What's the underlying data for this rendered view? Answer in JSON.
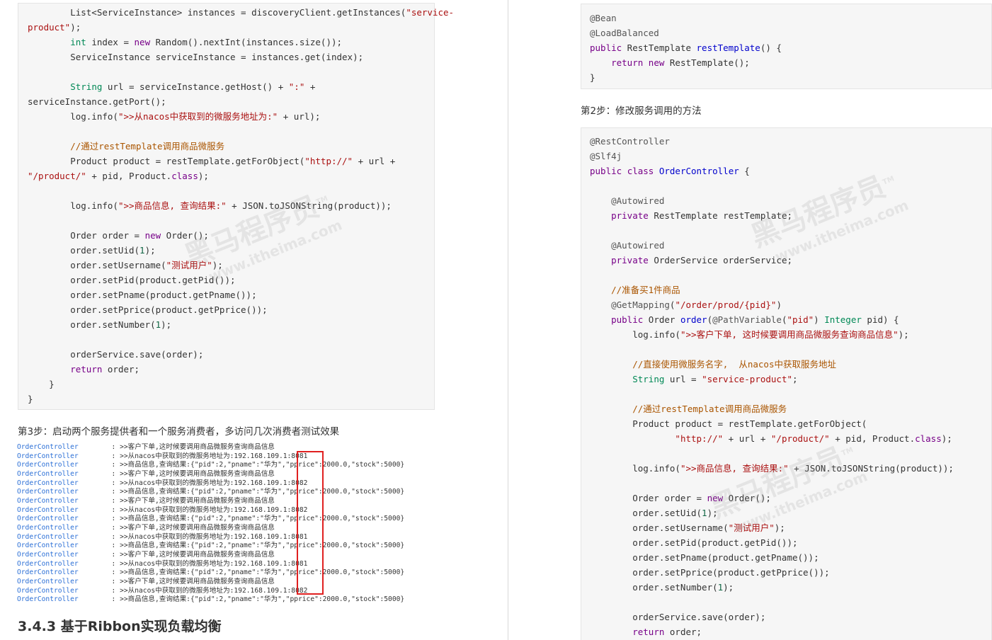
{
  "left": {
    "code_lines": [
      [
        [
          "t",
          "        List<ServiceInstance> instances = discoveryClient.getInstances("
        ],
        [
          "st",
          "\"service-"
        ]
      ],
      [
        [
          "st",
          "product\""
        ],
        [
          "t",
          ");"
        ]
      ],
      [
        [
          "t",
          "        "
        ],
        [
          "ty",
          "int"
        ],
        [
          "t",
          " index = "
        ],
        [
          "kw",
          "new"
        ],
        [
          "t",
          " Random().nextInt(instances.size());"
        ]
      ],
      [
        [
          "t",
          "        ServiceInstance serviceInstance = instances.get(index);"
        ]
      ],
      [
        [
          "t",
          ""
        ]
      ],
      [
        [
          "t",
          "        "
        ],
        [
          "ty",
          "String"
        ],
        [
          "t",
          " url = serviceInstance.getHost() + "
        ],
        [
          "st",
          "\":\""
        ],
        [
          "t",
          " +"
        ]
      ],
      [
        [
          "t",
          "serviceInstance.getPort();"
        ]
      ],
      [
        [
          "t",
          "        log.info("
        ],
        [
          "st",
          "\">>从nacos中获取到的微服务地址为:\""
        ],
        [
          "t",
          " + url);"
        ]
      ],
      [
        [
          "t",
          ""
        ]
      ],
      [
        [
          "t",
          "        "
        ],
        [
          "cm",
          "//通过restTemplate调用商品微服务"
        ]
      ],
      [
        [
          "t",
          "        Product product = restTemplate.getForObject("
        ],
        [
          "st",
          "\"http://\""
        ],
        [
          "t",
          " + url +"
        ]
      ],
      [
        [
          "st",
          "\"/product/\""
        ],
        [
          "t",
          " + pid, Product."
        ],
        [
          "kw",
          "class"
        ],
        [
          "t",
          ");"
        ]
      ],
      [
        [
          "t",
          ""
        ]
      ],
      [
        [
          "t",
          "        log.info("
        ],
        [
          "st",
          "\">>商品信息, 查询结果:\""
        ],
        [
          "t",
          " + JSON.toJSONString(product));"
        ]
      ],
      [
        [
          "t",
          ""
        ]
      ],
      [
        [
          "t",
          "        Order order = "
        ],
        [
          "kw",
          "new"
        ],
        [
          "t",
          " Order();"
        ]
      ],
      [
        [
          "t",
          "        order.setUid("
        ],
        [
          "nm",
          "1"
        ],
        [
          "t",
          ");"
        ]
      ],
      [
        [
          "t",
          "        order.setUsername("
        ],
        [
          "st",
          "\"测试用户\""
        ],
        [
          "t",
          ");"
        ]
      ],
      [
        [
          "t",
          "        order.setPid(product.getPid());"
        ]
      ],
      [
        [
          "t",
          "        order.setPname(product.getPname());"
        ]
      ],
      [
        [
          "t",
          "        order.setPprice(product.getPprice());"
        ]
      ],
      [
        [
          "t",
          "        order.setNumber("
        ],
        [
          "nm",
          "1"
        ],
        [
          "t",
          ");"
        ]
      ],
      [
        [
          "t",
          ""
        ]
      ],
      [
        [
          "t",
          "        orderService.save(order);"
        ]
      ],
      [
        [
          "t",
          "        "
        ],
        [
          "kw",
          "return"
        ],
        [
          "t",
          " order;"
        ]
      ],
      [
        [
          "t",
          "    }"
        ]
      ],
      [
        [
          "t",
          "}"
        ]
      ]
    ],
    "step3": "第3步：启动两个服务提供者和一个服务消费者，多访问几次消费者测试效果",
    "log_lines": [
      [
        "OrderController",
        "  : >>客户下单,这时候要调用商品微服务查询商品信息"
      ],
      [
        "OrderController",
        "  : >>从nacos中获取到的微服务地址为:192.168.109.1:8081"
      ],
      [
        "OrderController",
        "  : >>商品信息,查询结果:{\"pid\":2,\"pname\":\"华为\",\"pprice\":2000.0,\"stock\":5000}"
      ],
      [
        "OrderController",
        "  : >>客户下单,这时候要调用商品微服务查询商品信息"
      ],
      [
        "OrderController",
        "  : >>从nacos中获取到的微服务地址为:192.168.109.1:8082"
      ],
      [
        "OrderController",
        "  : >>商品信息,查询结果:{\"pid\":2,\"pname\":\"华为\",\"pprice\":2000.0,\"stock\":5000}"
      ],
      [
        "OrderController",
        "  : >>客户下单,这时候要调用商品微服务查询商品信息"
      ],
      [
        "OrderController",
        "  : >>从nacos中获取到的微服务地址为:192.168.109.1:8082"
      ],
      [
        "OrderController",
        "  : >>商品信息,查询结果:{\"pid\":2,\"pname\":\"华为\",\"pprice\":2000.0,\"stock\":5000}"
      ],
      [
        "OrderController",
        "  : >>客户下单,这时候要调用商品微服务查询商品信息"
      ],
      [
        "OrderController",
        "  : >>从nacos中获取到的微服务地址为:192.168.109.1:8081"
      ],
      [
        "OrderController",
        "  : >>商品信息,查询结果:{\"pid\":2,\"pname\":\"华为\",\"pprice\":2000.0,\"stock\":5000}"
      ],
      [
        "OrderController",
        "  : >>客户下单,这时候要调用商品微服务查询商品信息"
      ],
      [
        "OrderController",
        "  : >>从nacos中获取到的微服务地址为:192.168.109.1:8081"
      ],
      [
        "OrderController",
        "  : >>商品信息,查询结果:{\"pid\":2,\"pname\":\"华为\",\"pprice\":2000.0,\"stock\":5000}"
      ],
      [
        "OrderController",
        "  : >>客户下单,这时候要调用商品微服务查询商品信息"
      ],
      [
        "OrderController",
        "  : >>从nacos中获取到的微服务地址为:192.168.109.1:8082"
      ],
      [
        "OrderController",
        "  : >>商品信息,查询结果:{\"pid\":2,\"pname\":\"华为\",\"pprice\":2000.0,\"stock\":5000}"
      ]
    ],
    "heading": "3.4.3 基于Ribbon实现负载均衡"
  },
  "right": {
    "code1_lines": [
      [
        [
          "an",
          "@Bean"
        ]
      ],
      [
        [
          "an",
          "@LoadBalanced"
        ]
      ],
      [
        [
          "kw",
          "public"
        ],
        [
          "t",
          " RestTemplate "
        ],
        [
          "fn",
          "restTemplate"
        ],
        [
          "t",
          "() {"
        ]
      ],
      [
        [
          "t",
          "    "
        ],
        [
          "kw",
          "return"
        ],
        [
          "t",
          " "
        ],
        [
          "kw",
          "new"
        ],
        [
          "t",
          " RestTemplate();"
        ]
      ],
      [
        [
          "t",
          "}"
        ]
      ]
    ],
    "step2": "第2步：修改服务调用的方法",
    "code2_lines": [
      [
        [
          "an",
          "@RestController"
        ]
      ],
      [
        [
          "an",
          "@Slf4j"
        ]
      ],
      [
        [
          "kw",
          "public"
        ],
        [
          "t",
          " "
        ],
        [
          "kw",
          "class"
        ],
        [
          "t",
          " "
        ],
        [
          "fn",
          "OrderController"
        ],
        [
          "t",
          " {"
        ]
      ],
      [
        [
          "t",
          ""
        ]
      ],
      [
        [
          "t",
          "    "
        ],
        [
          "an",
          "@Autowired"
        ]
      ],
      [
        [
          "t",
          "    "
        ],
        [
          "kw",
          "private"
        ],
        [
          "t",
          " RestTemplate restTemplate;"
        ]
      ],
      [
        [
          "t",
          ""
        ]
      ],
      [
        [
          "t",
          "    "
        ],
        [
          "an",
          "@Autowired"
        ]
      ],
      [
        [
          "t",
          "    "
        ],
        [
          "kw",
          "private"
        ],
        [
          "t",
          " OrderService orderService;"
        ]
      ],
      [
        [
          "t",
          ""
        ]
      ],
      [
        [
          "t",
          "    "
        ],
        [
          "cm",
          "//准备买1件商品"
        ]
      ],
      [
        [
          "t",
          "    "
        ],
        [
          "an",
          "@GetMapping"
        ],
        [
          "t",
          "("
        ],
        [
          "st",
          "\"/order/prod/{pid}\""
        ],
        [
          "t",
          ")"
        ]
      ],
      [
        [
          "t",
          "    "
        ],
        [
          "kw",
          "public"
        ],
        [
          "t",
          " Order "
        ],
        [
          "fn",
          "order"
        ],
        [
          "t",
          "("
        ],
        [
          "an",
          "@PathVariable"
        ],
        [
          "t",
          "("
        ],
        [
          "st",
          "\"pid\""
        ],
        [
          "t",
          ") "
        ],
        [
          "ty",
          "Integer"
        ],
        [
          "t",
          " pid) {"
        ]
      ],
      [
        [
          "t",
          "        log.info("
        ],
        [
          "st",
          "\">>客户下单, 这时候要调用商品微服务查询商品信息\""
        ],
        [
          "t",
          ");"
        ]
      ],
      [
        [
          "t",
          ""
        ]
      ],
      [
        [
          "t",
          "        "
        ],
        [
          "cm",
          "//直接使用微服务名字,  从nacos中获取服务地址"
        ]
      ],
      [
        [
          "t",
          "        "
        ],
        [
          "ty",
          "String"
        ],
        [
          "t",
          " url = "
        ],
        [
          "st",
          "\"service-product\""
        ],
        [
          "t",
          ";"
        ]
      ],
      [
        [
          "t",
          ""
        ]
      ],
      [
        [
          "t",
          "        "
        ],
        [
          "cm",
          "//通过restTemplate调用商品微服务"
        ]
      ],
      [
        [
          "t",
          "        Product product = restTemplate.getForObject("
        ]
      ],
      [
        [
          "t",
          "                "
        ],
        [
          "st",
          "\"http://\""
        ],
        [
          "t",
          " + url + "
        ],
        [
          "st",
          "\"/product/\""
        ],
        [
          "t",
          " + pid, Product."
        ],
        [
          "kw",
          "class"
        ],
        [
          "t",
          ");"
        ]
      ],
      [
        [
          "t",
          ""
        ]
      ],
      [
        [
          "t",
          "        log.info("
        ],
        [
          "st",
          "\">>商品信息, 查询结果:\""
        ],
        [
          "t",
          " + JSON.toJSONString(product));"
        ]
      ],
      [
        [
          "t",
          ""
        ]
      ],
      [
        [
          "t",
          "        Order order = "
        ],
        [
          "kw",
          "new"
        ],
        [
          "t",
          " Order();"
        ]
      ],
      [
        [
          "t",
          "        order.setUid("
        ],
        [
          "nm",
          "1"
        ],
        [
          "t",
          ");"
        ]
      ],
      [
        [
          "t",
          "        order.setUsername("
        ],
        [
          "st",
          "\"测试用户\""
        ],
        [
          "t",
          ");"
        ]
      ],
      [
        [
          "t",
          "        order.setPid(product.getPid());"
        ]
      ],
      [
        [
          "t",
          "        order.setPname(product.getPname());"
        ]
      ],
      [
        [
          "t",
          "        order.setPprice(product.getPprice());"
        ]
      ],
      [
        [
          "t",
          "        order.setNumber("
        ],
        [
          "nm",
          "1"
        ],
        [
          "t",
          ");"
        ]
      ],
      [
        [
          "t",
          ""
        ]
      ],
      [
        [
          "t",
          "        orderService.save(order);"
        ]
      ],
      [
        [
          "t",
          "        "
        ],
        [
          "kw",
          "return"
        ],
        [
          "t",
          " order;"
        ]
      ]
    ]
  },
  "watermark": {
    "brand": "黑马程序员",
    "tm": "TM",
    "url": "www.itheima.com"
  }
}
